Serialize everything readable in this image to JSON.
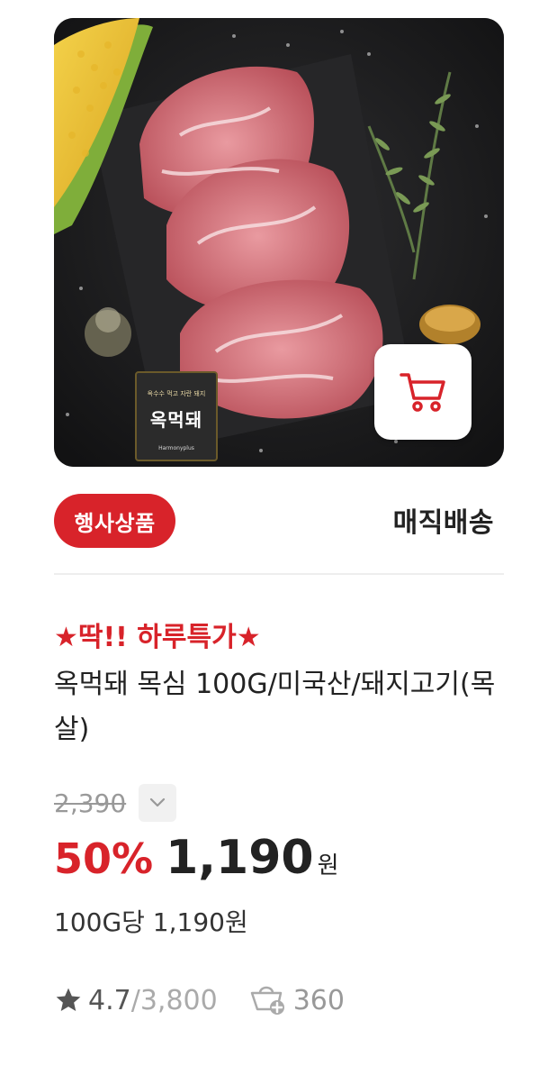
{
  "product": {
    "image_alt_icon": "product-photo",
    "brand_badge": {
      "subtitle": "옥수수 먹고 자란 돼지",
      "name": "옥먹돼",
      "english": "Harmonyplus"
    },
    "event_badge": "행사상품",
    "delivery": "매직배송",
    "promo_title": "★딱!! 하루특가★",
    "name": "옥먹돼 목심 100G/미국산/돼지고기(목살)",
    "original_price": "2,390",
    "discount": "50%",
    "sale_price": "1,190",
    "currency": "원",
    "unit_price": "100G당 1,190원",
    "rating": "4.7",
    "rating_separator": "/",
    "review_count": "3,800",
    "cart_count": "360"
  },
  "colors": {
    "accent": "#d8232a",
    "text": "#222222",
    "muted": "#999999"
  },
  "icons": {
    "cart": "cart-icon",
    "toggle": "chevron-down-icon",
    "star": "star-icon",
    "cart_add": "cart-plus-icon"
  }
}
